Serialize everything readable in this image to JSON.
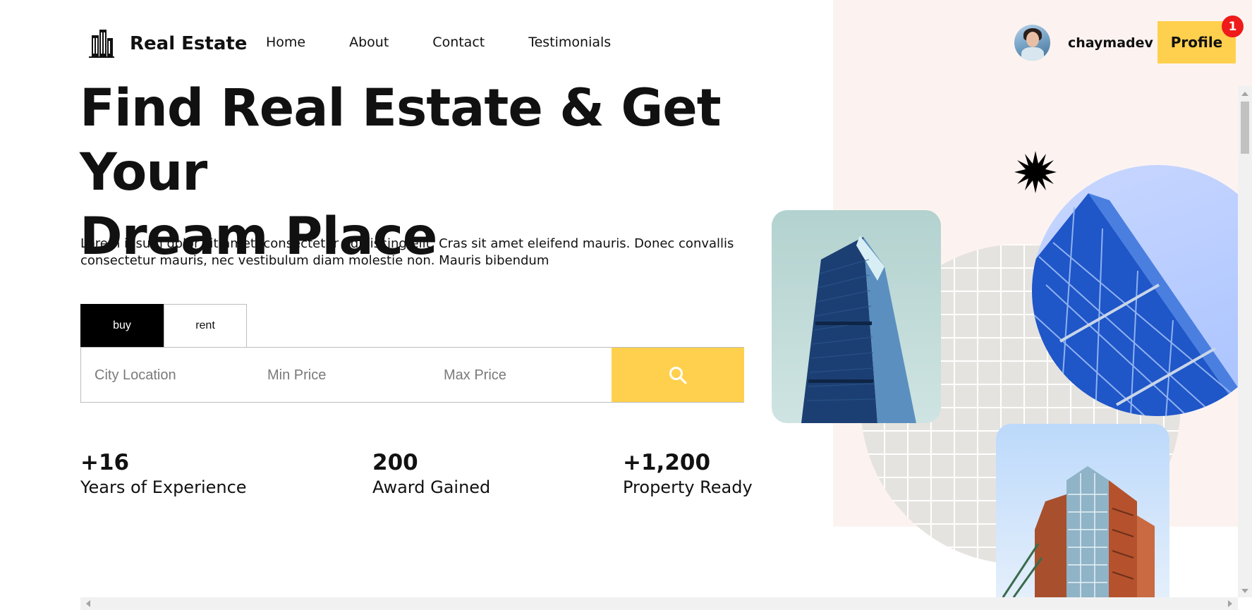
{
  "header": {
    "brand": "Real Estate",
    "nav": [
      "Home",
      "About",
      "Contact",
      "Testimonials"
    ],
    "username": "chaymadev",
    "profile_label": "Profile",
    "notification_count": "1"
  },
  "hero": {
    "title_line1": "Find Real Estate & Get Your",
    "title_line2": "Dream Place",
    "description": "Lorem ipsum dolor sit amet, consectetur adipiscing elit. Cras sit amet eleifend mauris. Donec convallis consectetur mauris, nec vestibulum diam molestie non. Mauris bibendum"
  },
  "search": {
    "tabs": [
      "buy",
      "rent"
    ],
    "active_tab": "buy",
    "city_placeholder": "City Location",
    "min_placeholder": "Min Price",
    "max_placeholder": "Max Price",
    "button_icon": "search-icon"
  },
  "stats": [
    {
      "value": "+16",
      "label": "Years of Experience"
    },
    {
      "value": "200",
      "label": "Award Gained"
    },
    {
      "value": "+1,200",
      "label": "Property Ready"
    }
  ],
  "colors": {
    "accent": "#ffd04d",
    "badge": "#ef1a1a",
    "panel": "#fcf3f1",
    "dark": "#000000"
  }
}
